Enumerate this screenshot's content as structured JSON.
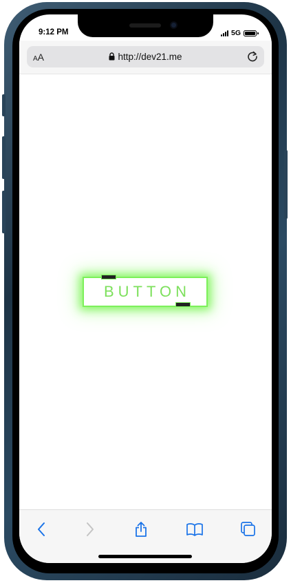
{
  "status_bar": {
    "time": "9:12 PM",
    "network": "5G"
  },
  "browser": {
    "text_size_label": {
      "small": "A",
      "large": "A"
    },
    "url": "http://dev21.me",
    "accent_color": "#1a73e8"
  },
  "page": {
    "button_label": "BUTTON",
    "button_color": "#7cf05a"
  },
  "toolbar": {
    "icons": [
      "back-icon",
      "forward-icon",
      "share-icon",
      "bookmarks-icon",
      "tabs-icon"
    ]
  }
}
